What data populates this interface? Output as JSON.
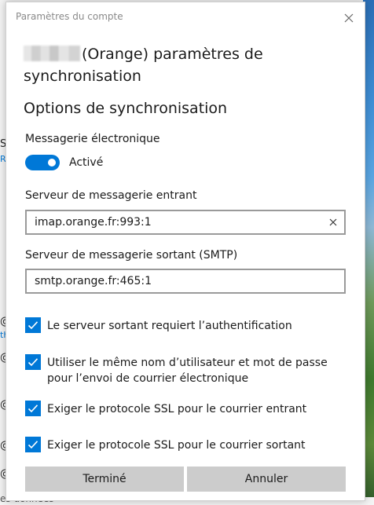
{
  "window": {
    "title": "Paramètres du compte"
  },
  "dialog": {
    "heading_suffix": "(Orange) paramètres de synchronisation",
    "section_title": "Options de synchronisation",
    "email": {
      "label": "Messagerie électronique",
      "toggle_state": "Activé",
      "toggle_on": true
    },
    "incoming": {
      "label": "Serveur de messagerie entrant",
      "value": "imap.orange.fr:993:1"
    },
    "outgoing": {
      "label": "Serveur de messagerie sortant (SMTP)",
      "value": "smtp.orange.fr:465:1"
    },
    "checks": [
      {
        "label": "Le serveur sortant requiert l’authentification",
        "checked": true
      },
      {
        "label": "Utiliser le même nom d’utilisateur et mot de passe pour l’envoi de courrier électronique",
        "checked": true
      },
      {
        "label": "Exiger le protocole SSL pour le courrier entrant",
        "checked": true
      },
      {
        "label": "Exiger le protocole SSL pour le courrier sortant",
        "checked": true
      }
    ],
    "buttons": {
      "done": "Terminé",
      "cancel": "Annuler"
    }
  },
  "background": {
    "fragments": [
      "S",
      "Re",
      "@",
      "th",
      "@",
      "@",
      "@",
      "@"
    ],
    "bottom_text": "es données"
  },
  "colors": {
    "accent": "#0078d7",
    "button_bg": "#cccccc",
    "input_border": "#9a9a9a"
  }
}
